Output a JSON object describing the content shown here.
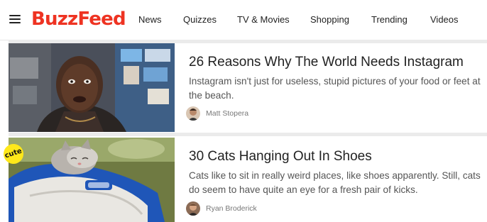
{
  "header": {
    "logo": "BuzzFeed",
    "nav": [
      "News",
      "Quizzes",
      "TV & Movies",
      "Shopping",
      "Trending",
      "Videos"
    ]
  },
  "posts": [
    {
      "title": "26 Reasons Why The World Needs Instagram",
      "description": "Instagram isn't just for useless, stupid pictures of your food or feet at the beach.",
      "author": "Matt Stopera"
    },
    {
      "title": "30 Cats Hanging Out In Shoes",
      "description": "Cats like to sit in really weird places, like shoes apparently. Still, cats do seem to have quite an eye for a fresh pair of kicks.",
      "author": "Ryan Broderick",
      "badge": "cute"
    }
  ],
  "colors": {
    "brand": "#ee3322",
    "divider": "#ebebeb",
    "badge": "#ffe81a"
  }
}
